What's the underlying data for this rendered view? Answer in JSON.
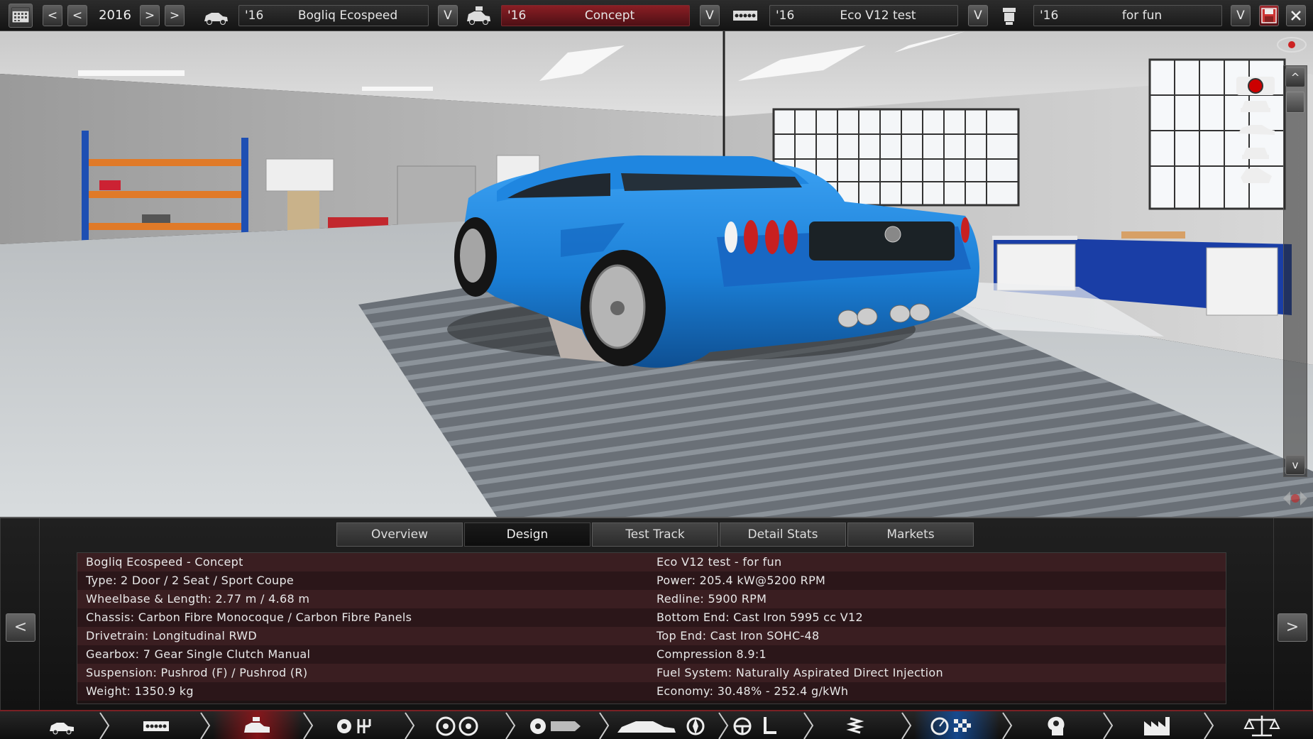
{
  "topbar": {
    "year": "2016",
    "prev_label": "<",
    "prev2_label": "<",
    "next_label": ">",
    "next2_label": ">",
    "dropdown_label": "V",
    "fields": [
      {
        "year": "'16",
        "name": "Bogliq Ecospeed"
      },
      {
        "year": "'16",
        "name": "Concept"
      },
      {
        "year": "'16",
        "name": "Eco V12 test"
      },
      {
        "year": "'16",
        "name": "for fun"
      }
    ]
  },
  "scene": {
    "scroll_up": "^",
    "scroll_down": "v"
  },
  "panel": {
    "tabs": [
      "Overview",
      "Design",
      "Test Track",
      "Detail Stats",
      "Markets"
    ],
    "active_tab": "Design",
    "left_button": "<",
    "right_button": ">",
    "left_column": [
      "Bogliq Ecospeed - Concept",
      "Type: 2 Door / 2 Seat / Sport Coupe",
      "Wheelbase & Length: 2.77 m / 4.68 m",
      "Chassis: Carbon Fibre Monocoque / Carbon Fibre Panels",
      "Drivetrain: Longitudinal RWD",
      "Gearbox: 7 Gear Single Clutch Manual",
      "Suspension: Pushrod (F) / Pushrod (R)",
      "Weight: 1350.9 kg"
    ],
    "right_column": [
      "Eco V12 test - for fun",
      "Power: 205.4 kW@5200 RPM",
      "Redline: 5900 RPM",
      "Bottom End: Cast Iron 5995 cc V12",
      "Top End: Cast Iron SOHC-48",
      "Compression 8.9:1",
      "Fuel System: Naturally Aspirated Direct Injection",
      "Economy: 30.48% - 252.4 g/kWh"
    ]
  },
  "colors": {
    "car_blue": "#1f86e0",
    "accent_red": "#8a1e24",
    "row_odd": "#3a1e21",
    "row_even": "#2b1619"
  }
}
